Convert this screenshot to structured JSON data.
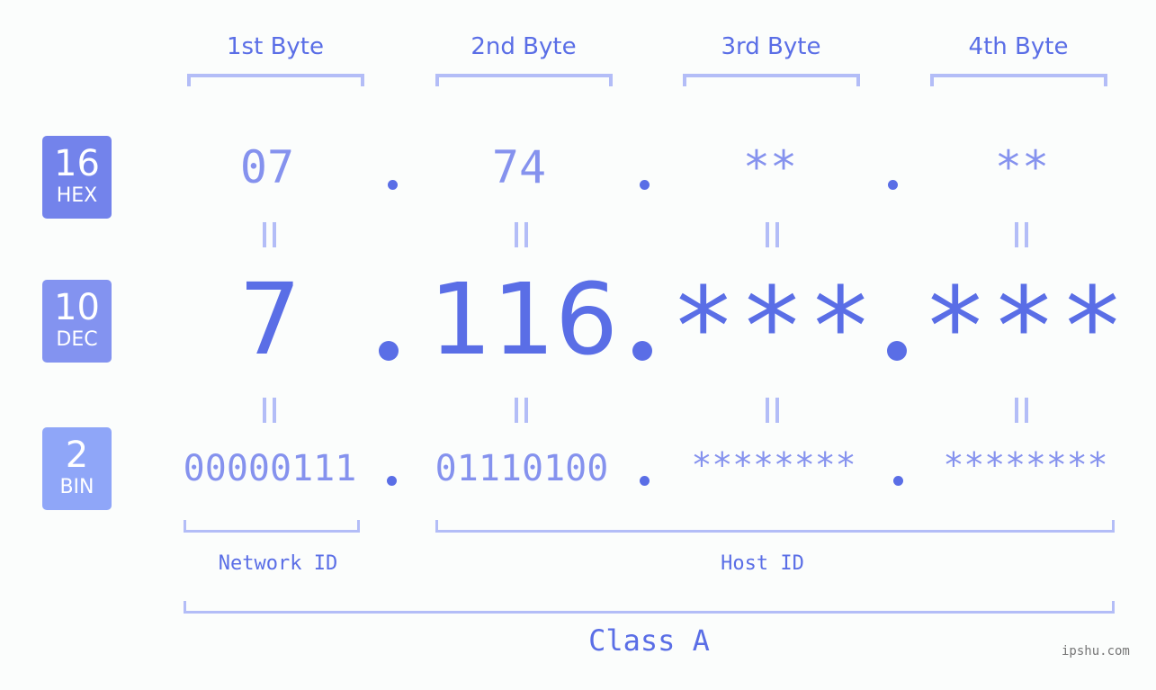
{
  "badges": [
    {
      "num": "16",
      "label": "HEX",
      "color": "#7383eb"
    },
    {
      "num": "10",
      "label": "DEC",
      "color": "#8393f0"
    },
    {
      "num": "2",
      "label": "BIN",
      "color": "#8fa6f8"
    }
  ],
  "bytes": [
    {
      "title": "1st Byte",
      "hex": "07",
      "dec": "7",
      "bin": "00000111"
    },
    {
      "title": "2nd Byte",
      "hex": "74",
      "dec": "116",
      "bin": "01110100"
    },
    {
      "title": "3rd Byte",
      "hex": "**",
      "dec": "***",
      "bin": "********"
    },
    {
      "title": "4th Byte",
      "hex": "**",
      "dec": "***",
      "bin": "********"
    }
  ],
  "labels": {
    "network_id": "Network ID",
    "host_id": "Host ID",
    "class": "Class A"
  },
  "watermark": "ipshu.com",
  "colors": {
    "accent": "#5a6ee6",
    "light_accent": "#8592ee",
    "bracket": "#b3bdf7",
    "background": "#fbfdfc"
  }
}
